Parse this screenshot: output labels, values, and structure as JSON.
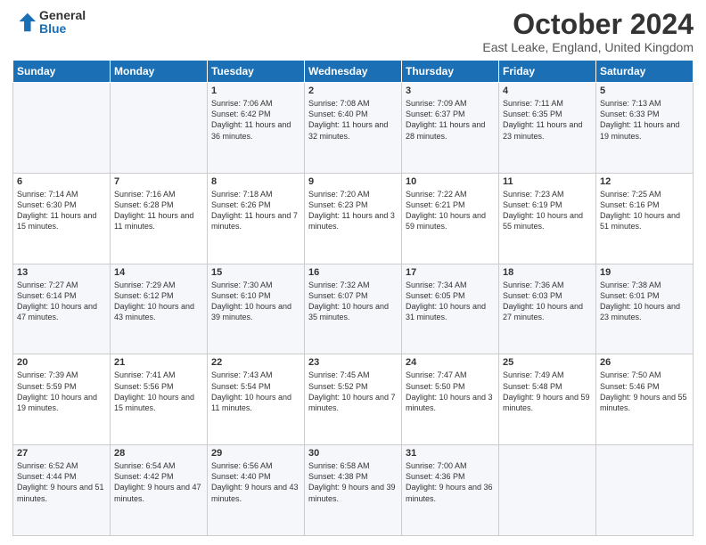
{
  "logo": {
    "general": "General",
    "blue": "Blue"
  },
  "header": {
    "title": "October 2024",
    "location": "East Leake, England, United Kingdom"
  },
  "weekdays": [
    "Sunday",
    "Monday",
    "Tuesday",
    "Wednesday",
    "Thursday",
    "Friday",
    "Saturday"
  ],
  "weeks": [
    [
      {
        "day": "",
        "sunrise": "",
        "sunset": "",
        "daylight": ""
      },
      {
        "day": "",
        "sunrise": "",
        "sunset": "",
        "daylight": ""
      },
      {
        "day": "1",
        "sunrise": "Sunrise: 7:06 AM",
        "sunset": "Sunset: 6:42 PM",
        "daylight": "Daylight: 11 hours and 36 minutes."
      },
      {
        "day": "2",
        "sunrise": "Sunrise: 7:08 AM",
        "sunset": "Sunset: 6:40 PM",
        "daylight": "Daylight: 11 hours and 32 minutes."
      },
      {
        "day": "3",
        "sunrise": "Sunrise: 7:09 AM",
        "sunset": "Sunset: 6:37 PM",
        "daylight": "Daylight: 11 hours and 28 minutes."
      },
      {
        "day": "4",
        "sunrise": "Sunrise: 7:11 AM",
        "sunset": "Sunset: 6:35 PM",
        "daylight": "Daylight: 11 hours and 23 minutes."
      },
      {
        "day": "5",
        "sunrise": "Sunrise: 7:13 AM",
        "sunset": "Sunset: 6:33 PM",
        "daylight": "Daylight: 11 hours and 19 minutes."
      }
    ],
    [
      {
        "day": "6",
        "sunrise": "Sunrise: 7:14 AM",
        "sunset": "Sunset: 6:30 PM",
        "daylight": "Daylight: 11 hours and 15 minutes."
      },
      {
        "day": "7",
        "sunrise": "Sunrise: 7:16 AM",
        "sunset": "Sunset: 6:28 PM",
        "daylight": "Daylight: 11 hours and 11 minutes."
      },
      {
        "day": "8",
        "sunrise": "Sunrise: 7:18 AM",
        "sunset": "Sunset: 6:26 PM",
        "daylight": "Daylight: 11 hours and 7 minutes."
      },
      {
        "day": "9",
        "sunrise": "Sunrise: 7:20 AM",
        "sunset": "Sunset: 6:23 PM",
        "daylight": "Daylight: 11 hours and 3 minutes."
      },
      {
        "day": "10",
        "sunrise": "Sunrise: 7:22 AM",
        "sunset": "Sunset: 6:21 PM",
        "daylight": "Daylight: 10 hours and 59 minutes."
      },
      {
        "day": "11",
        "sunrise": "Sunrise: 7:23 AM",
        "sunset": "Sunset: 6:19 PM",
        "daylight": "Daylight: 10 hours and 55 minutes."
      },
      {
        "day": "12",
        "sunrise": "Sunrise: 7:25 AM",
        "sunset": "Sunset: 6:16 PM",
        "daylight": "Daylight: 10 hours and 51 minutes."
      }
    ],
    [
      {
        "day": "13",
        "sunrise": "Sunrise: 7:27 AM",
        "sunset": "Sunset: 6:14 PM",
        "daylight": "Daylight: 10 hours and 47 minutes."
      },
      {
        "day": "14",
        "sunrise": "Sunrise: 7:29 AM",
        "sunset": "Sunset: 6:12 PM",
        "daylight": "Daylight: 10 hours and 43 minutes."
      },
      {
        "day": "15",
        "sunrise": "Sunrise: 7:30 AM",
        "sunset": "Sunset: 6:10 PM",
        "daylight": "Daylight: 10 hours and 39 minutes."
      },
      {
        "day": "16",
        "sunrise": "Sunrise: 7:32 AM",
        "sunset": "Sunset: 6:07 PM",
        "daylight": "Daylight: 10 hours and 35 minutes."
      },
      {
        "day": "17",
        "sunrise": "Sunrise: 7:34 AM",
        "sunset": "Sunset: 6:05 PM",
        "daylight": "Daylight: 10 hours and 31 minutes."
      },
      {
        "day": "18",
        "sunrise": "Sunrise: 7:36 AM",
        "sunset": "Sunset: 6:03 PM",
        "daylight": "Daylight: 10 hours and 27 minutes."
      },
      {
        "day": "19",
        "sunrise": "Sunrise: 7:38 AM",
        "sunset": "Sunset: 6:01 PM",
        "daylight": "Daylight: 10 hours and 23 minutes."
      }
    ],
    [
      {
        "day": "20",
        "sunrise": "Sunrise: 7:39 AM",
        "sunset": "Sunset: 5:59 PM",
        "daylight": "Daylight: 10 hours and 19 minutes."
      },
      {
        "day": "21",
        "sunrise": "Sunrise: 7:41 AM",
        "sunset": "Sunset: 5:56 PM",
        "daylight": "Daylight: 10 hours and 15 minutes."
      },
      {
        "day": "22",
        "sunrise": "Sunrise: 7:43 AM",
        "sunset": "Sunset: 5:54 PM",
        "daylight": "Daylight: 10 hours and 11 minutes."
      },
      {
        "day": "23",
        "sunrise": "Sunrise: 7:45 AM",
        "sunset": "Sunset: 5:52 PM",
        "daylight": "Daylight: 10 hours and 7 minutes."
      },
      {
        "day": "24",
        "sunrise": "Sunrise: 7:47 AM",
        "sunset": "Sunset: 5:50 PM",
        "daylight": "Daylight: 10 hours and 3 minutes."
      },
      {
        "day": "25",
        "sunrise": "Sunrise: 7:49 AM",
        "sunset": "Sunset: 5:48 PM",
        "daylight": "Daylight: 9 hours and 59 minutes."
      },
      {
        "day": "26",
        "sunrise": "Sunrise: 7:50 AM",
        "sunset": "Sunset: 5:46 PM",
        "daylight": "Daylight: 9 hours and 55 minutes."
      }
    ],
    [
      {
        "day": "27",
        "sunrise": "Sunrise: 6:52 AM",
        "sunset": "Sunset: 4:44 PM",
        "daylight": "Daylight: 9 hours and 51 minutes."
      },
      {
        "day": "28",
        "sunrise": "Sunrise: 6:54 AM",
        "sunset": "Sunset: 4:42 PM",
        "daylight": "Daylight: 9 hours and 47 minutes."
      },
      {
        "day": "29",
        "sunrise": "Sunrise: 6:56 AM",
        "sunset": "Sunset: 4:40 PM",
        "daylight": "Daylight: 9 hours and 43 minutes."
      },
      {
        "day": "30",
        "sunrise": "Sunrise: 6:58 AM",
        "sunset": "Sunset: 4:38 PM",
        "daylight": "Daylight: 9 hours and 39 minutes."
      },
      {
        "day": "31",
        "sunrise": "Sunrise: 7:00 AM",
        "sunset": "Sunset: 4:36 PM",
        "daylight": "Daylight: 9 hours and 36 minutes."
      },
      {
        "day": "",
        "sunrise": "",
        "sunset": "",
        "daylight": ""
      },
      {
        "day": "",
        "sunrise": "",
        "sunset": "",
        "daylight": ""
      }
    ]
  ]
}
